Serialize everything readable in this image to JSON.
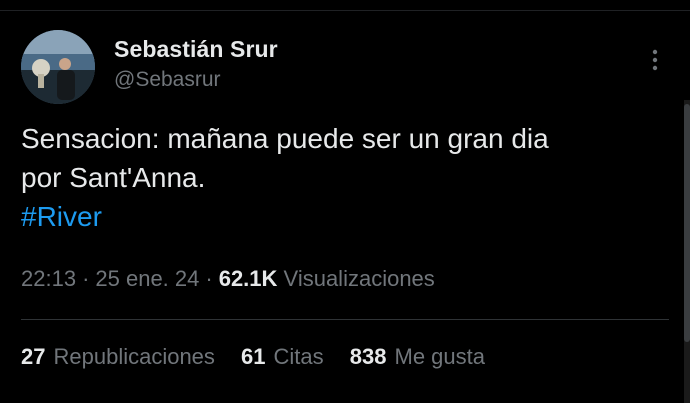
{
  "author": {
    "name": "Sebastián Srur",
    "handle": "@Sebasrur"
  },
  "tweet": {
    "line1": "Sensacion: mañana puede ser un gran dia",
    "line2": "por Sant'Anna.",
    "hashtag": "#River"
  },
  "meta": {
    "time": "22:13",
    "date": "25 ene. 24",
    "separator": "·",
    "views_count": "62.1K",
    "views_label": "Visualizaciones"
  },
  "stats": {
    "reposts_count": "27",
    "reposts_label": "Republicaciones",
    "quotes_count": "61",
    "quotes_label": "Citas",
    "likes_count": "838",
    "likes_label": "Me gusta"
  },
  "icons": {
    "more": "more-vertical-icon"
  },
  "colors": {
    "background": "#000000",
    "text_primary": "#e7e9ea",
    "text_secondary": "#71767b",
    "hashtag": "#1d9bf0",
    "divider": "#2f3336"
  }
}
